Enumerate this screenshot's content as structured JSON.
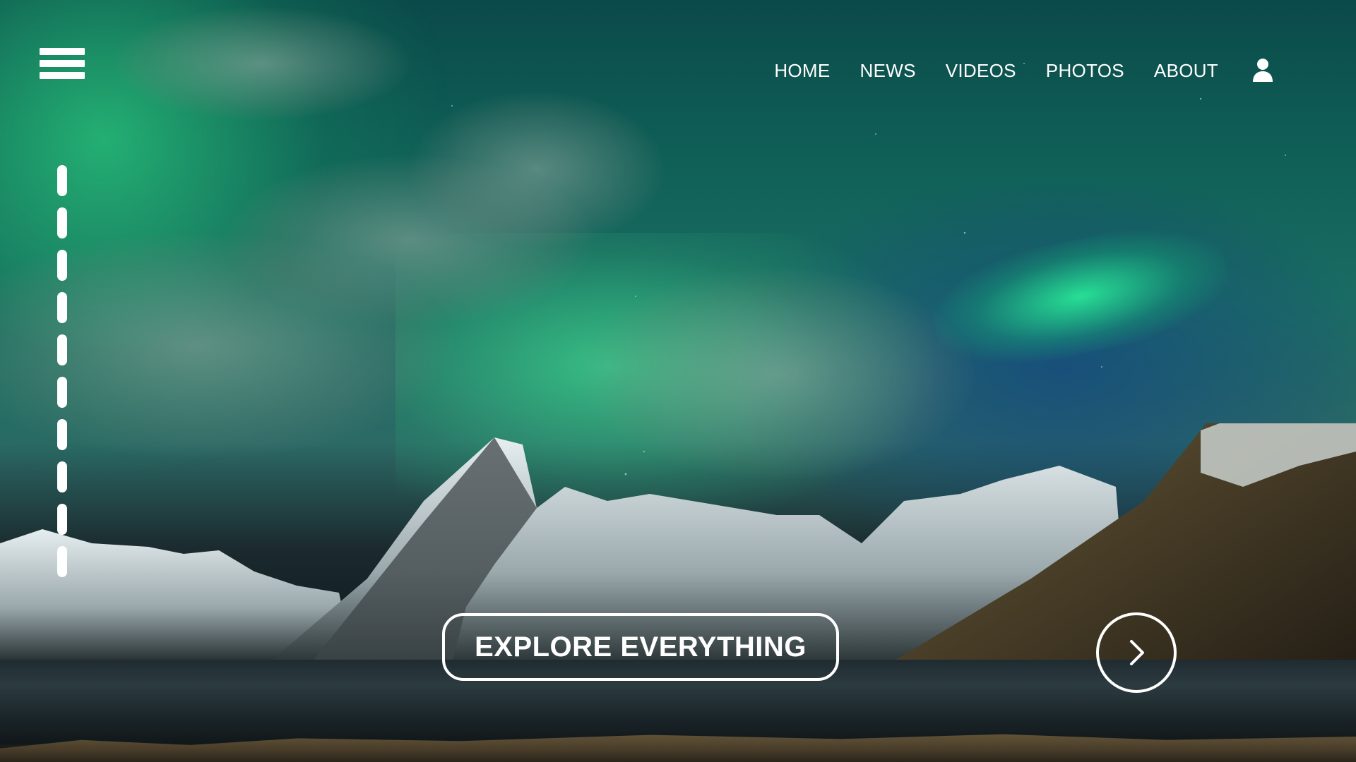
{
  "header": {
    "menu_icon": "hamburger-menu-icon",
    "nav": [
      {
        "label": "HOME"
      },
      {
        "label": "NEWS"
      },
      {
        "label": "VIDEOS"
      },
      {
        "label": "PHOTOS"
      },
      {
        "label": "ABOUT"
      }
    ],
    "user_icon": "user-icon"
  },
  "slider": {
    "indicator_count": 10
  },
  "hero": {
    "cta_label": "EXPLORE EVERYTHING",
    "next_icon": "chevron-right-icon"
  },
  "colors": {
    "ui_foreground": "#ffffff"
  }
}
